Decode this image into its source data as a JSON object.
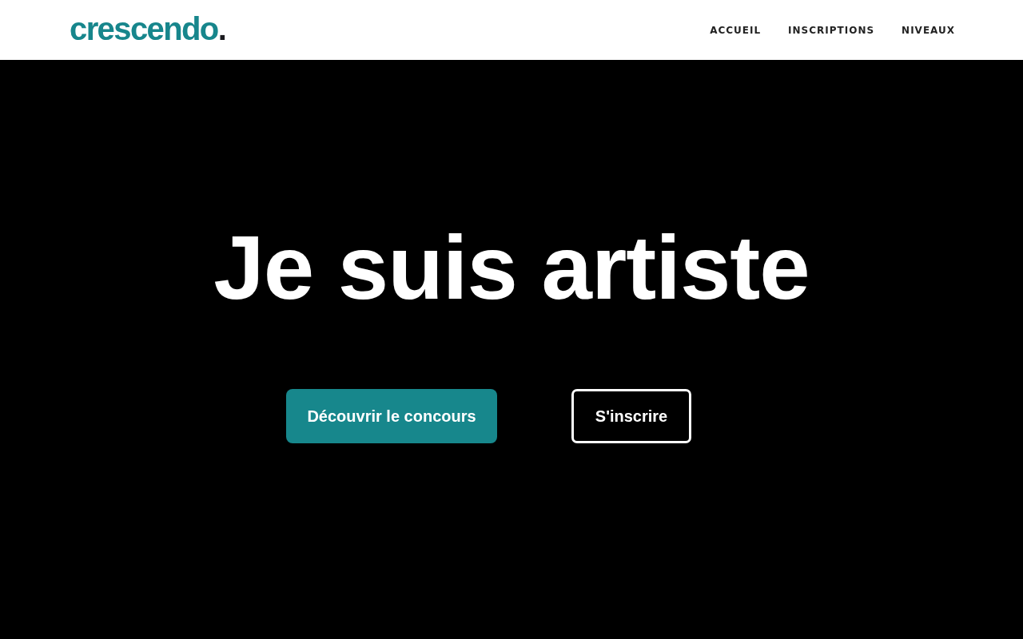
{
  "header": {
    "logo": {
      "text": "crescendo",
      "dot": "."
    },
    "nav": [
      {
        "label": "ACCUEIL"
      },
      {
        "label": "INSCRIPTIONS"
      },
      {
        "label": "NIVEAUX"
      }
    ]
  },
  "hero": {
    "title": "Je suis artiste",
    "buttons": [
      {
        "label": "Découvrir le concours",
        "kind": "filled"
      },
      {
        "label": "S'inscrire",
        "kind": "outline"
      }
    ]
  }
}
